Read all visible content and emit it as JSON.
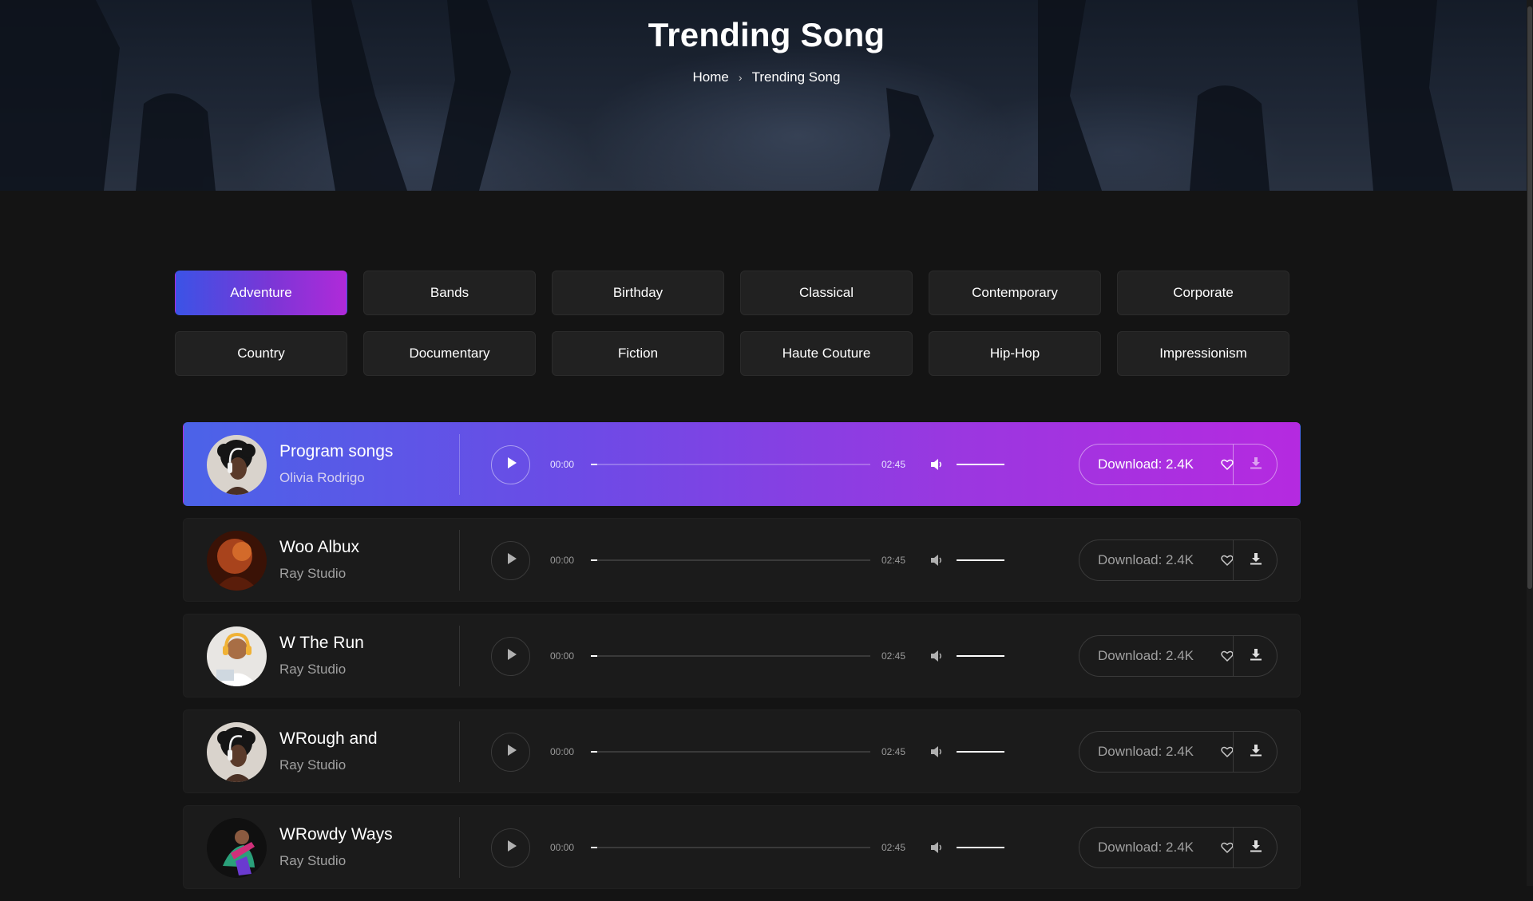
{
  "hero": {
    "title": "Trending Song",
    "breadcrumb": {
      "home": "Home",
      "current": "Trending Song"
    }
  },
  "categories": [
    "Adventure",
    "Bands",
    "Birthday",
    "Classical",
    "Contemporary",
    "Corporate",
    "Country",
    "Documentary",
    "Fiction",
    "Haute Couture",
    "Hip-Hop",
    "Impressionism"
  ],
  "active_category": "Adventure",
  "tracks": [
    {
      "title": "Program songs",
      "artist": "Olivia Rodrigo",
      "start": "00:00",
      "end": "02:45",
      "download": "Download: 2.4K",
      "progress": 0.0,
      "volume": 1.0,
      "active": true,
      "avatar": "headphones-woman"
    },
    {
      "title": "Woo Albux",
      "artist": "Ray Studio",
      "start": "00:00",
      "end": "02:45",
      "download": "Download: 2.4K",
      "progress": 0.0,
      "volume": 1.0,
      "active": false,
      "avatar": "fire-performer"
    },
    {
      "title": "W The Run",
      "artist": "Ray Studio",
      "start": "00:00",
      "end": "02:45",
      "download": "Download: 2.4K",
      "progress": 0.0,
      "volume": 1.0,
      "active": false,
      "avatar": "headphones-man"
    },
    {
      "title": "WRough and",
      "artist": "Ray Studio",
      "start": "00:00",
      "end": "02:45",
      "download": "Download: 2.4K",
      "progress": 0.0,
      "volume": 1.0,
      "active": false,
      "avatar": "headphones-woman"
    },
    {
      "title": "WRowdy Ways",
      "artist": "Ray Studio",
      "start": "00:00",
      "end": "02:45",
      "download": "Download: 2.4K",
      "progress": 0.0,
      "volume": 1.0,
      "active": false,
      "avatar": "dancer"
    }
  ],
  "colors": {
    "accent_start": "#3b53e6",
    "accent_mid": "#7a36d6",
    "accent_end": "#b52ae0",
    "background": "#141414",
    "card": "#1b1b1b"
  }
}
